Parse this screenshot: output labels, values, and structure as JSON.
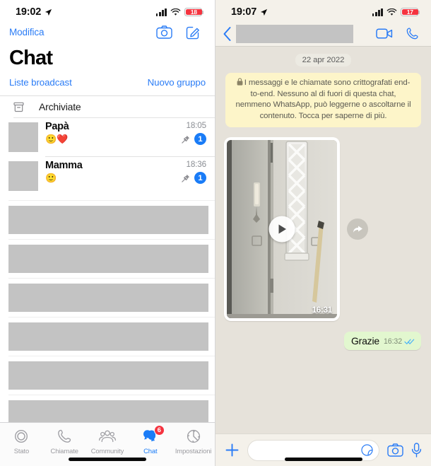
{
  "left_panel": {
    "status_bar": {
      "time": "19:02",
      "battery_level": "18",
      "location_icon": "location-arrow-icon",
      "signal_icon": "cellular-bars-icon",
      "wifi_icon": "wifi-icon"
    },
    "nav": {
      "edit_label": "Modifica",
      "camera_icon": "camera-icon",
      "compose_icon": "compose-icon"
    },
    "title": "Chat",
    "subrow": {
      "broadcast_label": "Liste broadcast",
      "new_group_label": "Nuovo gruppo"
    },
    "archived": {
      "label": "Archiviate",
      "icon": "archive-box-icon"
    },
    "chats": [
      {
        "name": "Papà",
        "preview": "🙂❤️",
        "time": "18:05",
        "pinned": true,
        "unread": "1",
        "pin_icon": "pin-icon"
      },
      {
        "name": "Mamma",
        "preview": "🙂",
        "time": "18:36",
        "pinned": true,
        "unread": "1",
        "pin_icon": "pin-icon"
      }
    ],
    "redacted_rows": 6,
    "tabs": [
      {
        "label": "Stato",
        "icon": "status-rings-icon",
        "active": false,
        "badge": ""
      },
      {
        "label": "Chiamate",
        "icon": "phone-icon",
        "active": false,
        "badge": ""
      },
      {
        "label": "Community",
        "icon": "community-icon",
        "active": false,
        "badge": ""
      },
      {
        "label": "Chat",
        "icon": "chat-bubbles-icon",
        "active": true,
        "badge": "6"
      },
      {
        "label": "Impostazioni",
        "icon": "gear-icon",
        "active": false,
        "badge": ""
      }
    ]
  },
  "right_panel": {
    "status_bar": {
      "time": "19:07",
      "battery_level": "17",
      "location_icon": "location-arrow-icon",
      "signal_icon": "cellular-bars-icon",
      "wifi_icon": "wifi-icon"
    },
    "header": {
      "back_icon": "back-chevron-icon",
      "contact_name": "",
      "video_call_icon": "video-call-icon",
      "voice_call_icon": "phone-call-icon"
    },
    "date_divider": "22 apr 2022",
    "encryption_notice": "I messaggi e le chiamate sono crittografati end-to-end. Nessuno al di fuori di questa chat, nemmeno WhatsApp, può leggerne o ascoltarne il contenuto. Tocca per saperne di più.",
    "encryption_lock_icon": "lock-icon",
    "messages": [
      {
        "type": "video",
        "direction": "incoming",
        "duration": "16:31",
        "play_icon": "play-icon",
        "forward_icon": "forward-arrow-icon"
      },
      {
        "type": "text",
        "direction": "outgoing",
        "text": "Grazie",
        "time": "16:32",
        "status_icon": "double-check-icon"
      }
    ],
    "input_bar": {
      "plus_icon": "plus-icon",
      "placeholder": "",
      "sticker_icon": "sticker-icon",
      "camera_icon": "camera-icon",
      "mic_icon": "microphone-icon"
    }
  },
  "colors": {
    "ios_blue": "#1a7cf7",
    "badge_red": "#f5333f",
    "bubble_green": "#e2f7cf",
    "encryption_yellow": "#fdf5c9",
    "wallpaper": "#e6e2da"
  }
}
